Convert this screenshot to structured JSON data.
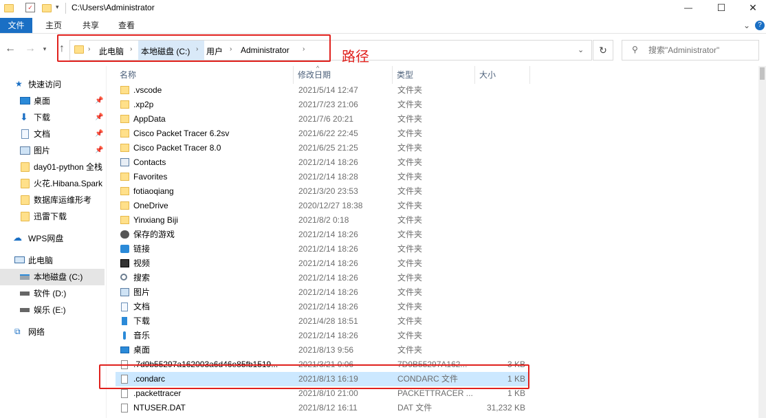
{
  "window": {
    "title": "C:\\Users\\Administrator",
    "minimize": "—",
    "maximize": "☐",
    "close": "✕"
  },
  "ribbon": {
    "tabs": [
      "文件",
      "主页",
      "共享",
      "查看"
    ],
    "expand": "⌄",
    "help": "?"
  },
  "address": {
    "crumbs": [
      "此电脑",
      "本地磁盘 (C:)",
      "用户",
      "Administrator"
    ],
    "search_placeholder": "搜索\"Administrator\"",
    "annotation": "路径"
  },
  "nav": {
    "quick_access": "快速访问",
    "pinned": [
      {
        "label": "桌面",
        "icon": "desktop-icon"
      },
      {
        "label": "下载",
        "icon": "download-icon"
      },
      {
        "label": "文档",
        "icon": "document-icon"
      },
      {
        "label": "图片",
        "icon": "picture-icon"
      }
    ],
    "recent": [
      "day01-python 全栈",
      "火花.Hibana.Spark",
      "数据库运维形考",
      "迅雷下载"
    ],
    "wps": "WPS网盘",
    "this_pc": "此电脑",
    "drives": [
      "本地磁盘 (C:)",
      "软件 (D:)",
      "娱乐 (E:)"
    ],
    "network": "网络"
  },
  "list": {
    "columns": [
      "名称",
      "修改日期",
      "类型",
      "大小"
    ],
    "rows": [
      {
        "name": ".vscode",
        "date": "2021/5/14 12:47",
        "type": "文件夹",
        "size": "",
        "icon": "folder-icon"
      },
      {
        "name": ".xp2p",
        "date": "2021/7/23 21:06",
        "type": "文件夹",
        "size": "",
        "icon": "folder-icon"
      },
      {
        "name": "AppData",
        "date": "2021/7/6 20:21",
        "type": "文件夹",
        "size": "",
        "icon": "folder-icon"
      },
      {
        "name": "Cisco Packet Tracer 6.2sv",
        "date": "2021/6/22 22:45",
        "type": "文件夹",
        "size": "",
        "icon": "folder-icon"
      },
      {
        "name": "Cisco Packet Tracer 8.0",
        "date": "2021/6/25 21:25",
        "type": "文件夹",
        "size": "",
        "icon": "folder-icon"
      },
      {
        "name": "Contacts",
        "date": "2021/2/14 18:26",
        "type": "文件夹",
        "size": "",
        "icon": "contacts-icon"
      },
      {
        "name": "Favorites",
        "date": "2021/2/14 18:28",
        "type": "文件夹",
        "size": "",
        "icon": "folder-icon"
      },
      {
        "name": "fotiaoqiang",
        "date": "2021/3/20 23:53",
        "type": "文件夹",
        "size": "",
        "icon": "folder-icon"
      },
      {
        "name": "OneDrive",
        "date": "2020/12/27 18:38",
        "type": "文件夹",
        "size": "",
        "icon": "folder-icon"
      },
      {
        "name": "Yinxiang Biji",
        "date": "2021/8/2 0:18",
        "type": "文件夹",
        "size": "",
        "icon": "folder-icon"
      },
      {
        "name": "保存的游戏",
        "date": "2021/2/14 18:26",
        "type": "文件夹",
        "size": "",
        "icon": "saved-games-icon"
      },
      {
        "name": "链接",
        "date": "2021/2/14 18:26",
        "type": "文件夹",
        "size": "",
        "icon": "links-icon"
      },
      {
        "name": "视频",
        "date": "2021/2/14 18:26",
        "type": "文件夹",
        "size": "",
        "icon": "video-icon"
      },
      {
        "name": "搜索",
        "date": "2021/2/14 18:26",
        "type": "文件夹",
        "size": "",
        "icon": "search-icon"
      },
      {
        "name": "图片",
        "date": "2021/2/14 18:26",
        "type": "文件夹",
        "size": "",
        "icon": "picture-icon"
      },
      {
        "name": "文档",
        "date": "2021/2/14 18:26",
        "type": "文件夹",
        "size": "",
        "icon": "document-icon"
      },
      {
        "name": "下载",
        "date": "2021/4/28 18:51",
        "type": "文件夹",
        "size": "",
        "icon": "download-icon"
      },
      {
        "name": "音乐",
        "date": "2021/2/14 18:26",
        "type": "文件夹",
        "size": "",
        "icon": "music-icon"
      },
      {
        "name": "桌面",
        "date": "2021/8/13 9:56",
        "type": "文件夹",
        "size": "",
        "icon": "desktop-icon"
      },
      {
        "name": ".7d9b55297a162003a6d46e85fb1519...",
        "date": "2021/3/21 0:06",
        "type": "7D9B55297A162...",
        "size": "3 KB",
        "icon": "file-icon"
      },
      {
        "name": ".condarc",
        "date": "2021/8/13 16:19",
        "type": "CONDARC 文件",
        "size": "1 KB",
        "icon": "file-icon"
      },
      {
        "name": ".packettracer",
        "date": "2021/8/10 21:00",
        "type": "PACKETTRACER ...",
        "size": "1 KB",
        "icon": "file-icon"
      },
      {
        "name": "NTUSER.DAT",
        "date": "2021/8/12 16:11",
        "type": "DAT 文件",
        "size": "31,232 KB",
        "icon": "file-icon"
      }
    ]
  },
  "colors": {
    "accent": "#1a6fc4",
    "selection": "#cce8ff",
    "annotation": "#e0201c",
    "folder": "#ffe08a"
  }
}
